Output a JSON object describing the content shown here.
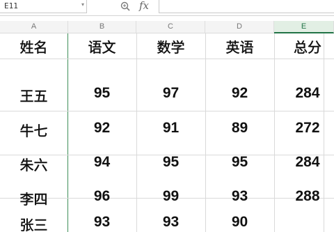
{
  "formula_bar": {
    "cell_reference": "E11",
    "fx_label": "fx",
    "formula_value": ""
  },
  "columns": [
    {
      "letter": "A",
      "header": "姓名"
    },
    {
      "letter": "B",
      "header": "语文"
    },
    {
      "letter": "C",
      "header": "数学"
    },
    {
      "letter": "D",
      "header": "英语"
    },
    {
      "letter": "E",
      "header": "总分"
    }
  ],
  "active_column": "E",
  "rows": [
    {
      "name": "王五",
      "chinese": "95",
      "math": "97",
      "english": "92",
      "total": "284"
    },
    {
      "name": "牛七",
      "chinese": "92",
      "math": "91",
      "english": "89",
      "total": "272"
    },
    {
      "name": "朱六",
      "chinese": "94",
      "math": "95",
      "english": "95",
      "total": "284"
    },
    {
      "name": "李四",
      "chinese": "96",
      "math": "99",
      "english": "93",
      "total": "288"
    },
    {
      "name": "张三",
      "chinese": "93",
      "math": "93",
      "english": "90",
      "total": ""
    }
  ],
  "colors": {
    "grid_line": "#d9d9d9",
    "freeze_line": "#3f8f58",
    "active_header_fill": "#e2efe4",
    "active_header_text": "#217346"
  }
}
